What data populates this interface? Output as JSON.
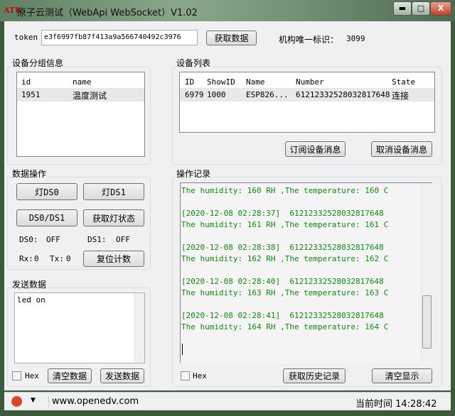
{
  "window": {
    "logo": "ATK",
    "title": "原子云测试（WebApi  WebSocket）V1.02",
    "min": "▬",
    "max": "□",
    "close": "X"
  },
  "top": {
    "token_label": "token",
    "token_value": "e3f6997fb87f413a9a566740492c3976",
    "fetch_button": "获取数据",
    "org_label": "机构唯一标识：",
    "org_value": "3099"
  },
  "groups": {
    "title": "设备分组信息",
    "columns": [
      "id",
      "name"
    ],
    "rows": [
      [
        "1951",
        "温度测试"
      ]
    ]
  },
  "devices": {
    "title": "设备列表",
    "columns": [
      "ID",
      "ShowID",
      "Name",
      "Number",
      "State"
    ],
    "rows": [
      [
        "6979",
        "1000",
        "ESP826...",
        "61212332528032817648",
        "连接"
      ]
    ],
    "subscribe_button": "订阅设备消息",
    "unsubscribe_button": "取消设备消息"
  },
  "ops": {
    "title": "数据操作",
    "btn_ds0": "灯DS0",
    "btn_ds1": "灯DS1",
    "btn_both": "DS0/DS1",
    "btn_state": "获取灯状态",
    "ds0_label": "DS0:",
    "ds0_value": "OFF",
    "ds1_label": "DS1:",
    "ds1_value": "OFF",
    "rx_label": "Rx:",
    "rx_value": "0",
    "tx_label": "Tx:",
    "tx_value": "0",
    "reset_button": "复位计数"
  },
  "send": {
    "title": "发送数据",
    "text": "led on",
    "hex_label": "Hex",
    "clear_button": "清空数据",
    "send_button": "发送数据"
  },
  "log": {
    "title": "操作记录",
    "lines": [
      "The humidity: 160 RH ,The temperature: 160 C",
      "",
      "[2020-12-08 02:28:37]  61212332528032817648",
      "The humidity: 161 RH ,The temperature: 161 C",
      "",
      "[2020-12-08 02:28:38]  61212332528032817648",
      "The humidity: 162 RH ,The temperature: 162 C",
      "",
      "[2020-12-08 02:28:40]  61212332528032817648",
      "The humidity: 163 RH ,The temperature: 163 C",
      "",
      "[2020-12-08 02:28:41]  61212332528032817648",
      "The humidity: 164 RH ,The temperature: 164 C"
    ],
    "hex_label": "Hex",
    "history_button": "获取历史记录",
    "clear_button": "清空显示"
  },
  "status": {
    "url": "www.openedv.com",
    "time": "当前时间 14:28:42"
  }
}
